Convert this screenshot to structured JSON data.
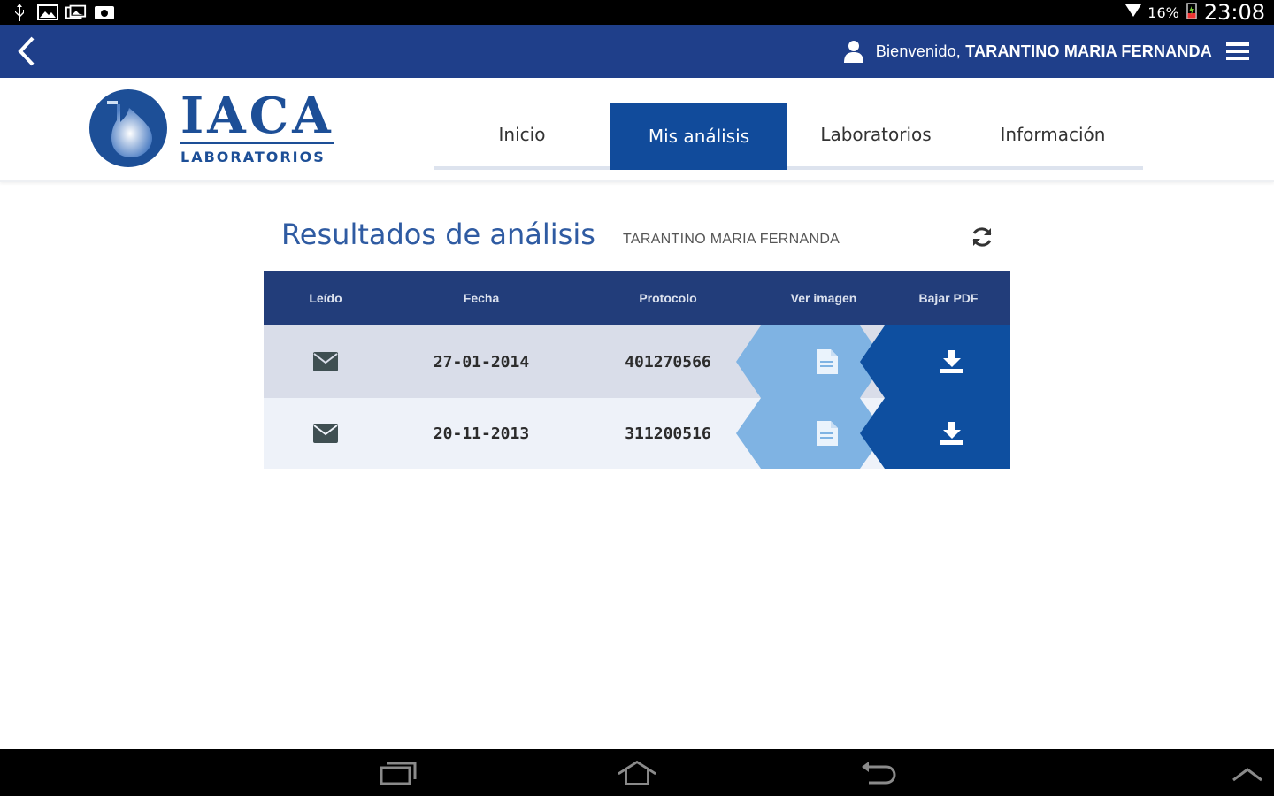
{
  "status_bar": {
    "battery": "16%",
    "time": "23:08"
  },
  "app_bar": {
    "welcome_prefix": "Bienvenido,",
    "user_name": "TARANTINO MARIA FERNANDA"
  },
  "logo": {
    "title": "IACA",
    "subtitle": "LABORATORIOS"
  },
  "tabs": [
    {
      "label": "Inicio"
    },
    {
      "label": "Mis análisis"
    },
    {
      "label": "Laboratorios"
    },
    {
      "label": "Información"
    }
  ],
  "results": {
    "title": "Resultados de análisis",
    "user": "TARANTINO MARIA FERNANDA"
  },
  "table": {
    "columns": [
      "Leído",
      "Fecha",
      "Protocolo",
      "Ver imagen",
      "Bajar PDF"
    ],
    "rows": [
      {
        "fecha": "27-01-2014",
        "protocolo": "401270566"
      },
      {
        "fecha": "20-11-2013",
        "protocolo": "311200516"
      }
    ]
  },
  "colors": {
    "app_bar": "#1f3f8a",
    "tab_active": "#114b9b",
    "table_header": "#223d7a",
    "view_arrow": "#7fb3e3",
    "pdf_arrow": "#0e4fa0"
  }
}
